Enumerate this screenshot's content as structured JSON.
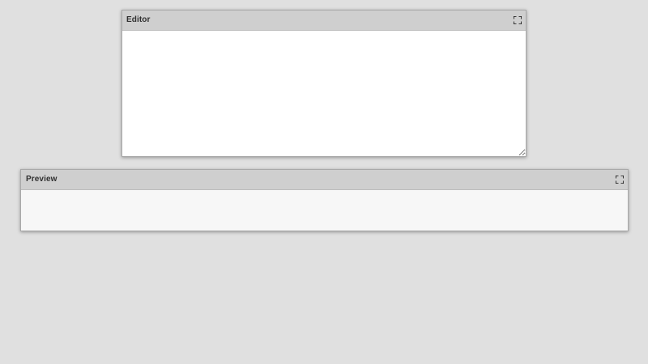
{
  "editor": {
    "title": "Editor",
    "maximize_icon": "maximize-icon",
    "content": ""
  },
  "preview": {
    "title": "Preview",
    "maximize_icon": "maximize-icon",
    "content": ""
  },
  "colors": {
    "background": "#e0e0e0",
    "header": "#cfcfcf",
    "editor_bg": "#ffffff",
    "preview_bg": "#f7f7f7"
  }
}
